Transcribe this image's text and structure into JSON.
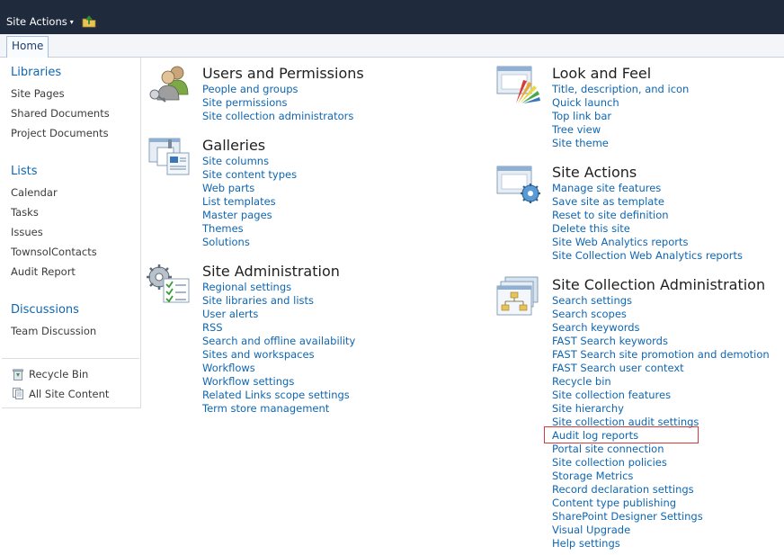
{
  "topbar": {
    "site_actions_label": "Site Actions",
    "caret": "▾"
  },
  "ribbon": {
    "home_tab": "Home"
  },
  "leftnav": {
    "libraries": {
      "heading": "Libraries",
      "items": [
        "Site Pages",
        "Shared Documents",
        "Project Documents"
      ]
    },
    "lists": {
      "heading": "Lists",
      "items": [
        "Calendar",
        "Tasks",
        "Issues",
        "TownsolContacts",
        "Audit Report"
      ]
    },
    "discussions": {
      "heading": "Discussions",
      "items": [
        "Team Discussion"
      ]
    },
    "footer": {
      "recycle_bin": "Recycle Bin",
      "all_site_content": "All Site Content"
    }
  },
  "sections": {
    "users": {
      "title": "Users and Permissions",
      "links": [
        "People and groups",
        "Site permissions",
        "Site collection administrators"
      ]
    },
    "galleries": {
      "title": "Galleries",
      "links": [
        "Site columns",
        "Site content types",
        "Web parts",
        "List templates",
        "Master pages",
        "Themes",
        "Solutions"
      ]
    },
    "siteadmin": {
      "title": "Site Administration",
      "links": [
        "Regional settings",
        "Site libraries and lists",
        "User alerts",
        "RSS",
        "Search and offline availability",
        "Sites and workspaces",
        "Workflows",
        "Workflow settings",
        "Related Links scope settings",
        "Term store management"
      ]
    },
    "lookfeel": {
      "title": "Look and Feel",
      "links": [
        "Title, description, and icon",
        "Quick launch",
        "Top link bar",
        "Tree view",
        "Site theme"
      ]
    },
    "siteactions": {
      "title": "Site Actions",
      "links": [
        "Manage site features",
        "Save site as template",
        "Reset to site definition",
        "Delete this site",
        "Site Web Analytics reports",
        "Site Collection Web Analytics reports"
      ]
    },
    "sitecollection": {
      "title": "Site Collection Administration",
      "links": [
        "Search settings",
        "Search scopes",
        "Search keywords",
        "FAST Search keywords",
        "FAST Search site promotion and demotion",
        "FAST Search user context",
        "Recycle bin",
        "Site collection features",
        "Site hierarchy",
        "Site collection audit settings",
        "Audit log reports",
        "Portal site connection",
        "Site collection policies",
        "Storage Metrics",
        "Record declaration settings",
        "Content type publishing",
        "SharePoint Designer Settings",
        "Visual Upgrade",
        "Help settings"
      ]
    }
  },
  "colors": {
    "topbar": "#1f2b3c",
    "link": "#0f66b1",
    "highlight": "#d73a3a"
  }
}
